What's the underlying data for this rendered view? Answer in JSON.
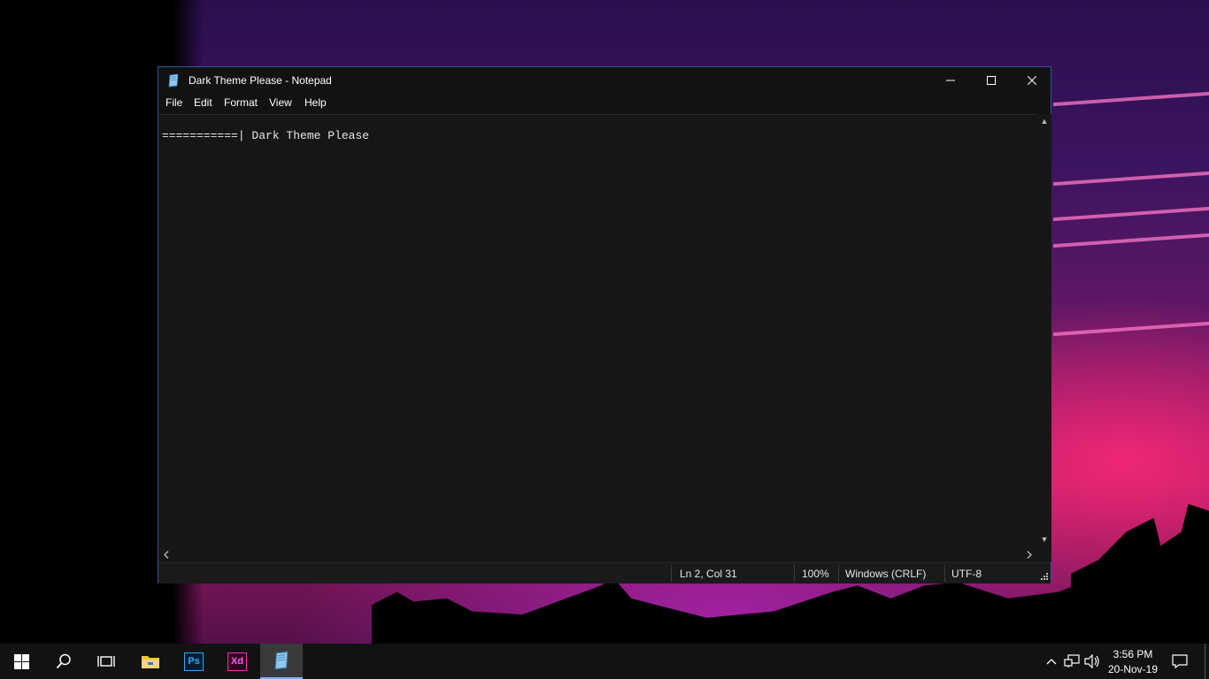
{
  "window": {
    "title": "Dark Theme Please - Notepad",
    "minimize_icon": "minimize-icon",
    "maximize_icon": "maximize-icon",
    "close_icon": "close-icon"
  },
  "menu": {
    "items": [
      "File",
      "Edit",
      "Format",
      "View",
      "Help"
    ]
  },
  "editor": {
    "content": "===========| Dark Theme Please"
  },
  "statusbar": {
    "position": "Ln 2, Col 31",
    "zoom": "100%",
    "line_ending": "Windows (CRLF)",
    "encoding": "UTF-8"
  },
  "taskbar": {
    "apps": [
      "start-icon",
      "search-icon",
      "task-view-icon",
      "file-explorer-icon",
      "photoshop-icon",
      "adobe-xd-icon",
      "notepad-icon"
    ],
    "photoshop_label": "Ps",
    "xd_label": "Xd",
    "clock_time": "3:56 PM",
    "clock_date": "20-Nov-19"
  },
  "colors": {
    "accent": "#2d5a9e",
    "window_bg": "#121212",
    "editor_bg": "#161616",
    "taskbar_bg": "#121212"
  }
}
